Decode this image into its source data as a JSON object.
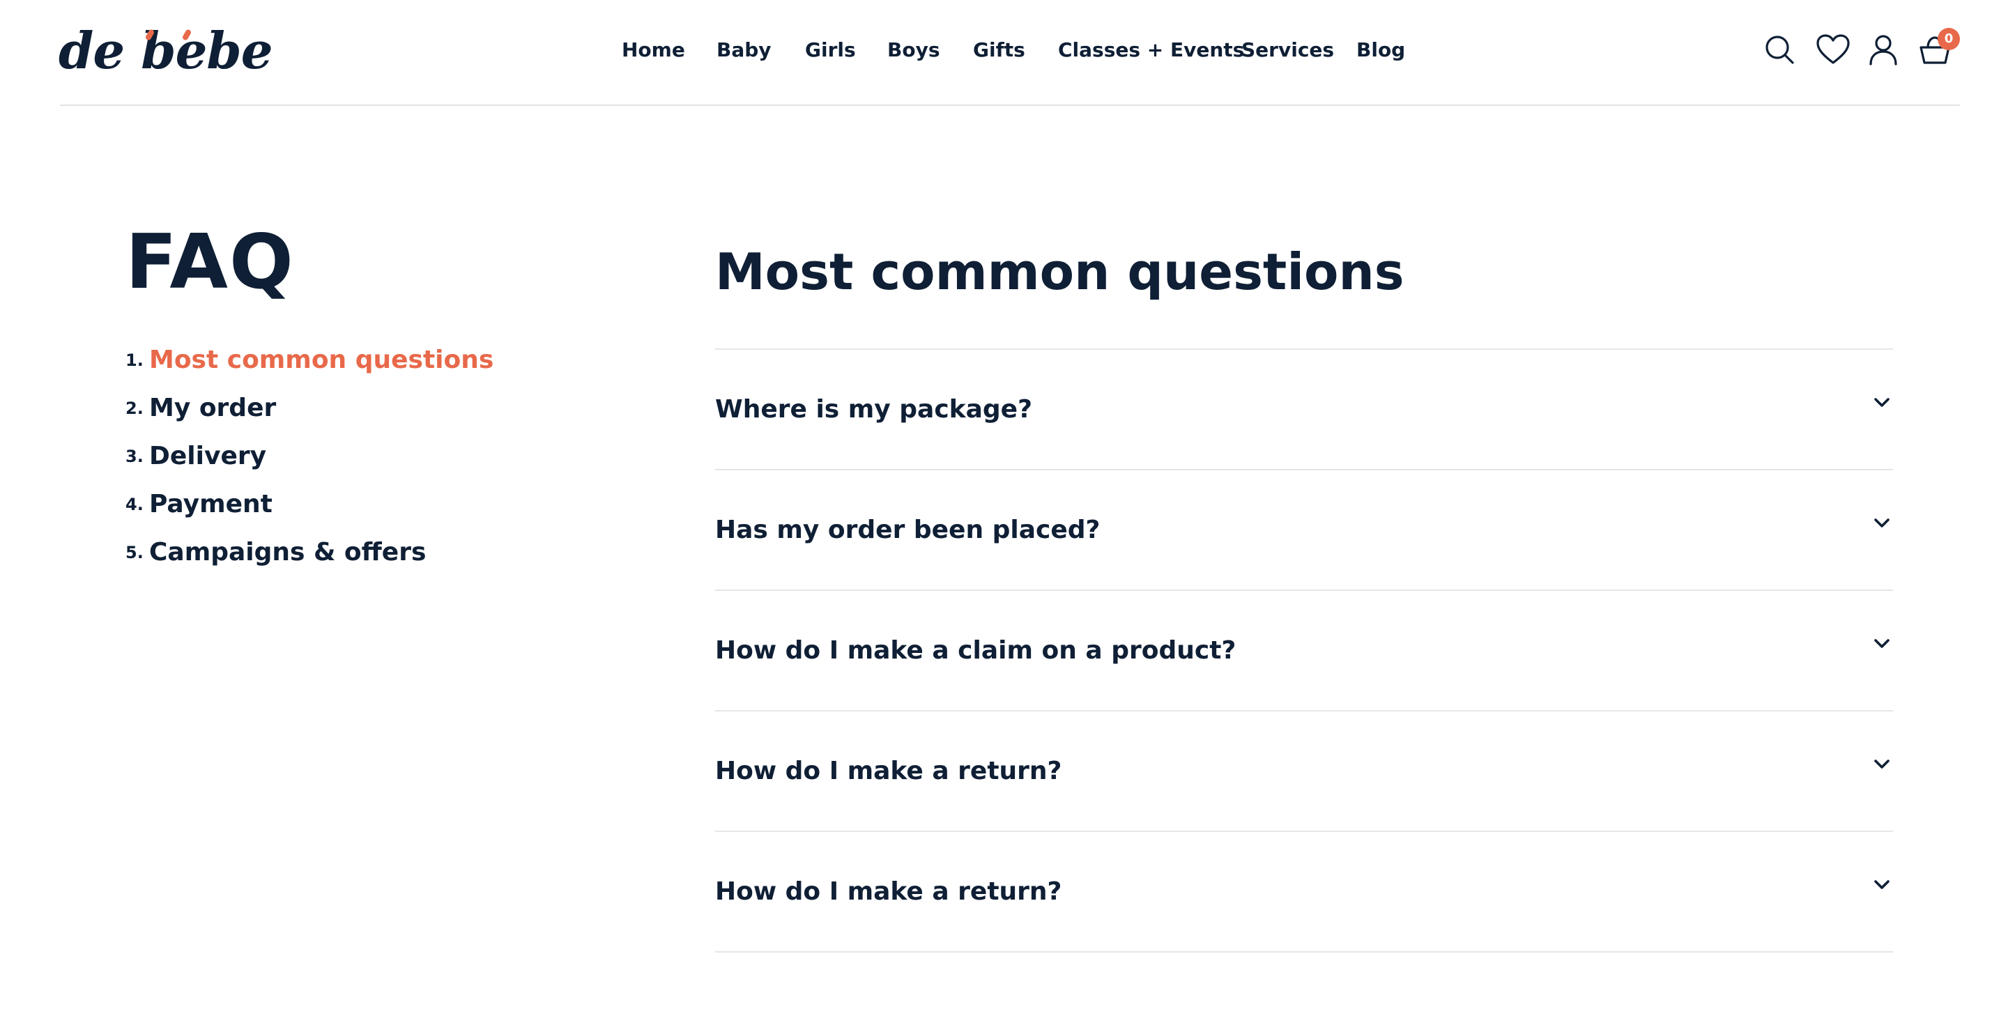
{
  "header": {
    "logo_text": "de bebe",
    "nav": [
      {
        "label": "Home"
      },
      {
        "label": "Baby"
      },
      {
        "label": "Girls"
      },
      {
        "label": "Boys"
      },
      {
        "label": "Gifts"
      },
      {
        "label": "Classes + Events"
      },
      {
        "label": "Services"
      },
      {
        "label": "Blog"
      }
    ],
    "icons": [
      "search-icon",
      "heart-icon",
      "user-icon",
      "basket-icon"
    ],
    "cart_count": "0"
  },
  "sidebar": {
    "title": "FAQ",
    "items": [
      {
        "number": "1.",
        "label": "Most common questions",
        "active": true
      },
      {
        "number": "2.",
        "label": "My order",
        "active": false
      },
      {
        "number": "3.",
        "label": "Delivery",
        "active": false
      },
      {
        "number": "4.",
        "label": "Payment",
        "active": false
      },
      {
        "number": "5.",
        "label": "Campaigns & offers",
        "active": false
      }
    ]
  },
  "main": {
    "title": "Most common questions",
    "questions": [
      {
        "label": "Where is my package?"
      },
      {
        "label": "Has my order been placed?"
      },
      {
        "label": "How do I make a claim on a product?"
      },
      {
        "label": "How do I make a return?"
      },
      {
        "label": "How do I make a return?"
      }
    ]
  },
  "colors": {
    "text": "#0f1f35",
    "accent": "#e8694a",
    "divider": "#e6e6e6",
    "background": "#ffffff"
  }
}
